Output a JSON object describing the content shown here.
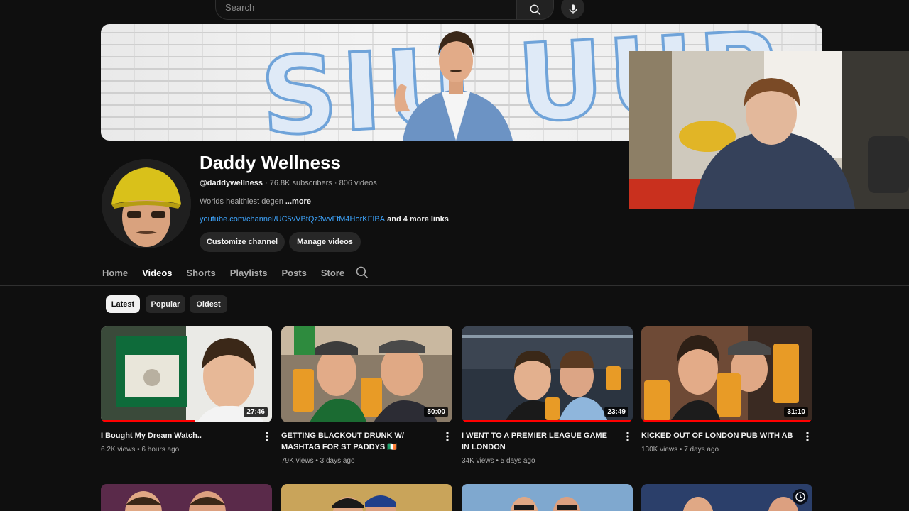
{
  "search": {
    "placeholder": "Search"
  },
  "icons": {
    "search": "search-icon",
    "mic": "microphone-icon",
    "tab_search": "search-icon",
    "more": "kebab-menu-icon",
    "watch_later": "clock-icon"
  },
  "banner": {
    "title": "SIU UUP"
  },
  "channel": {
    "name": "Daddy Wellness",
    "handle": "@daddywellness",
    "stats": " · 76.8K subscribers · 806 videos",
    "description": "Worlds healthiest degen ",
    "more_label": "...more",
    "link": "youtube.com/channel/UC5vVBtQz3wvFtM4HorKFIBA",
    "more_links": " and 4 more links",
    "customize_label": "Customize channel",
    "manage_label": "Manage videos"
  },
  "tabs": [
    "Home",
    "Videos",
    "Shorts",
    "Playlists",
    "Posts",
    "Store"
  ],
  "chips": [
    "Latest",
    "Popular",
    "Oldest"
  ],
  "videos": [
    {
      "title": "I Bought My Dream Watch..",
      "meta": "6.2K views • 6 hours ago",
      "duration": "27:46",
      "watched": 0.55
    },
    {
      "title": "GETTING BLACKOUT DRUNK W/ MASHTAG FOR ST PADDYS 🇮🇪",
      "meta": "79K views • 3 days ago",
      "duration": "50:00",
      "watched": 0
    },
    {
      "title": "I WENT TO A PREMIER LEAGUE GAME IN LONDON",
      "meta": "34K views • 5 days ago",
      "duration": "23:49",
      "watched": 1.0
    },
    {
      "title": "KICKED OUT OF LONDON PUB WITH AB",
      "meta": "130K views • 7 days ago",
      "duration": "31:10",
      "watched": 1.0
    }
  ],
  "colors": {
    "accent_link": "#3ea6ff",
    "progress": "#ff0000",
    "banner_text_stroke": "#6fa3d9"
  }
}
